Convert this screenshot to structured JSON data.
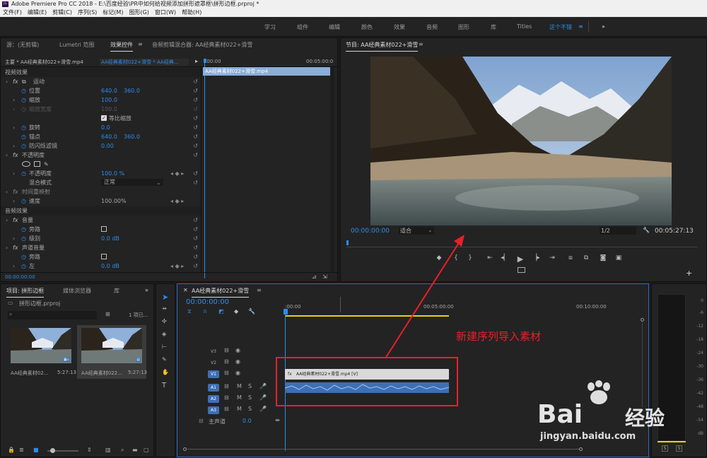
{
  "title_bar": {
    "app_icon": "Pr",
    "title": "Adobe Premiere Pro CC 2018 - E:\\百度经验\\PR中如何给视频添加拼形遮罩框\\拼形边框.prproj *"
  },
  "menu": [
    "文件(F)",
    "编辑(E)",
    "剪辑(C)",
    "序列(S)",
    "标记(M)",
    "图形(G)",
    "窗口(W)",
    "帮助(H)"
  ],
  "workspaces": [
    "学习",
    "组件",
    "编辑",
    "颜色",
    "效果",
    "音频",
    "图形",
    "库",
    "Titles",
    "这个不错"
  ],
  "workspace_active": "这个不错",
  "workspace_more": "»",
  "left_panel": {
    "tabs": [
      "源：(无剪辑)",
      "Lumetri 范围",
      "效果控件",
      "音频剪辑混合器: AA经典素材022+滑雪"
    ],
    "master_label": "主要 * AA经典素材022+滑雪.mp4",
    "clip_label": "AA经典素材022+滑雪 * AA经典...",
    "tl_start": ":00:00",
    "tl_end": "00:05:00:0",
    "clip_bar": "AA经典素材022+滑雪.mp4",
    "video_effects": "视频效果",
    "motion": "运动",
    "position": "位置",
    "position_x": "640.0",
    "position_y": "360.0",
    "scale": "缩放",
    "scale_val": "100.0",
    "scale_width": "缩放宽度",
    "scale_width_val": "100.0",
    "uniform_scale": "等比缩放",
    "rotation": "旋转",
    "rotation_val": "0.0",
    "anchor": "锚点",
    "anchor_x": "640.0",
    "anchor_y": "360.0",
    "antiflicker": "防闪烁滤镜",
    "antiflicker_val": "0.00",
    "opacity_section": "不透明度",
    "opacity": "不透明度",
    "opacity_val": "100.0 %",
    "blend_mode": "混合模式",
    "blend_val": "正常",
    "time_remap": "时间重映射",
    "speed": "速度",
    "speed_val": "100.00%",
    "audio_effects": "音频效果",
    "volume": "音量",
    "bypass": "旁路",
    "level": "级别",
    "level_val": "0.0 dB",
    "channel_volume": "声道音量",
    "bypass2": "旁路",
    "left": "左",
    "left_val": "0.0 dB",
    "timecode": "00:00:00:00"
  },
  "program": {
    "tab": "节目: AA经典素材022+滑雪",
    "timecode": "00:00:00:00",
    "fit": "适合",
    "quality": "1/2",
    "duration": "00:05:27:13"
  },
  "project": {
    "tabs": [
      "项目: 拼形边框",
      "媒体浏览器",
      "库"
    ],
    "file": "拼形边框.prproj",
    "items_count": "1 项已...",
    "items": [
      {
        "name": "AA经典素材02...",
        "duration": "5:27:13"
      },
      {
        "name": "AA经典素材022...",
        "duration": "5:27:13"
      }
    ]
  },
  "timeline": {
    "tab": "AA经典素材022+滑雪",
    "timecode": "00:00:00:00",
    "ruler": [
      ":00:00",
      "00:05:00:00",
      "00:10:00:00"
    ],
    "video_tracks": [
      "V3",
      "V2",
      "V1"
    ],
    "audio_tracks": [
      "A1",
      "A2",
      "A3"
    ],
    "master": "主声道",
    "master_val": "0.0",
    "clip_video": "AA经典素材022+滑雪.mp4 [V]",
    "annotation": "新建序列导入素材",
    "m": "M",
    "s": "S",
    "fx": "fx"
  },
  "meter": {
    "ticks": [
      "0",
      "-6",
      "-12",
      "-18",
      "-24",
      "-30",
      "-36",
      "-42",
      "-48",
      "-54",
      "dB"
    ],
    "solo": "S"
  },
  "watermark": {
    "brand": "Bai",
    "brand2": "经验",
    "url": "jingyan.baidu.com"
  },
  "colors": {
    "accent": "#2d8ceb",
    "annotation": "#e8202a",
    "clip": "#d9d9d9",
    "audio_clip": "#3d6fb5",
    "yellow": "#e6d600"
  }
}
